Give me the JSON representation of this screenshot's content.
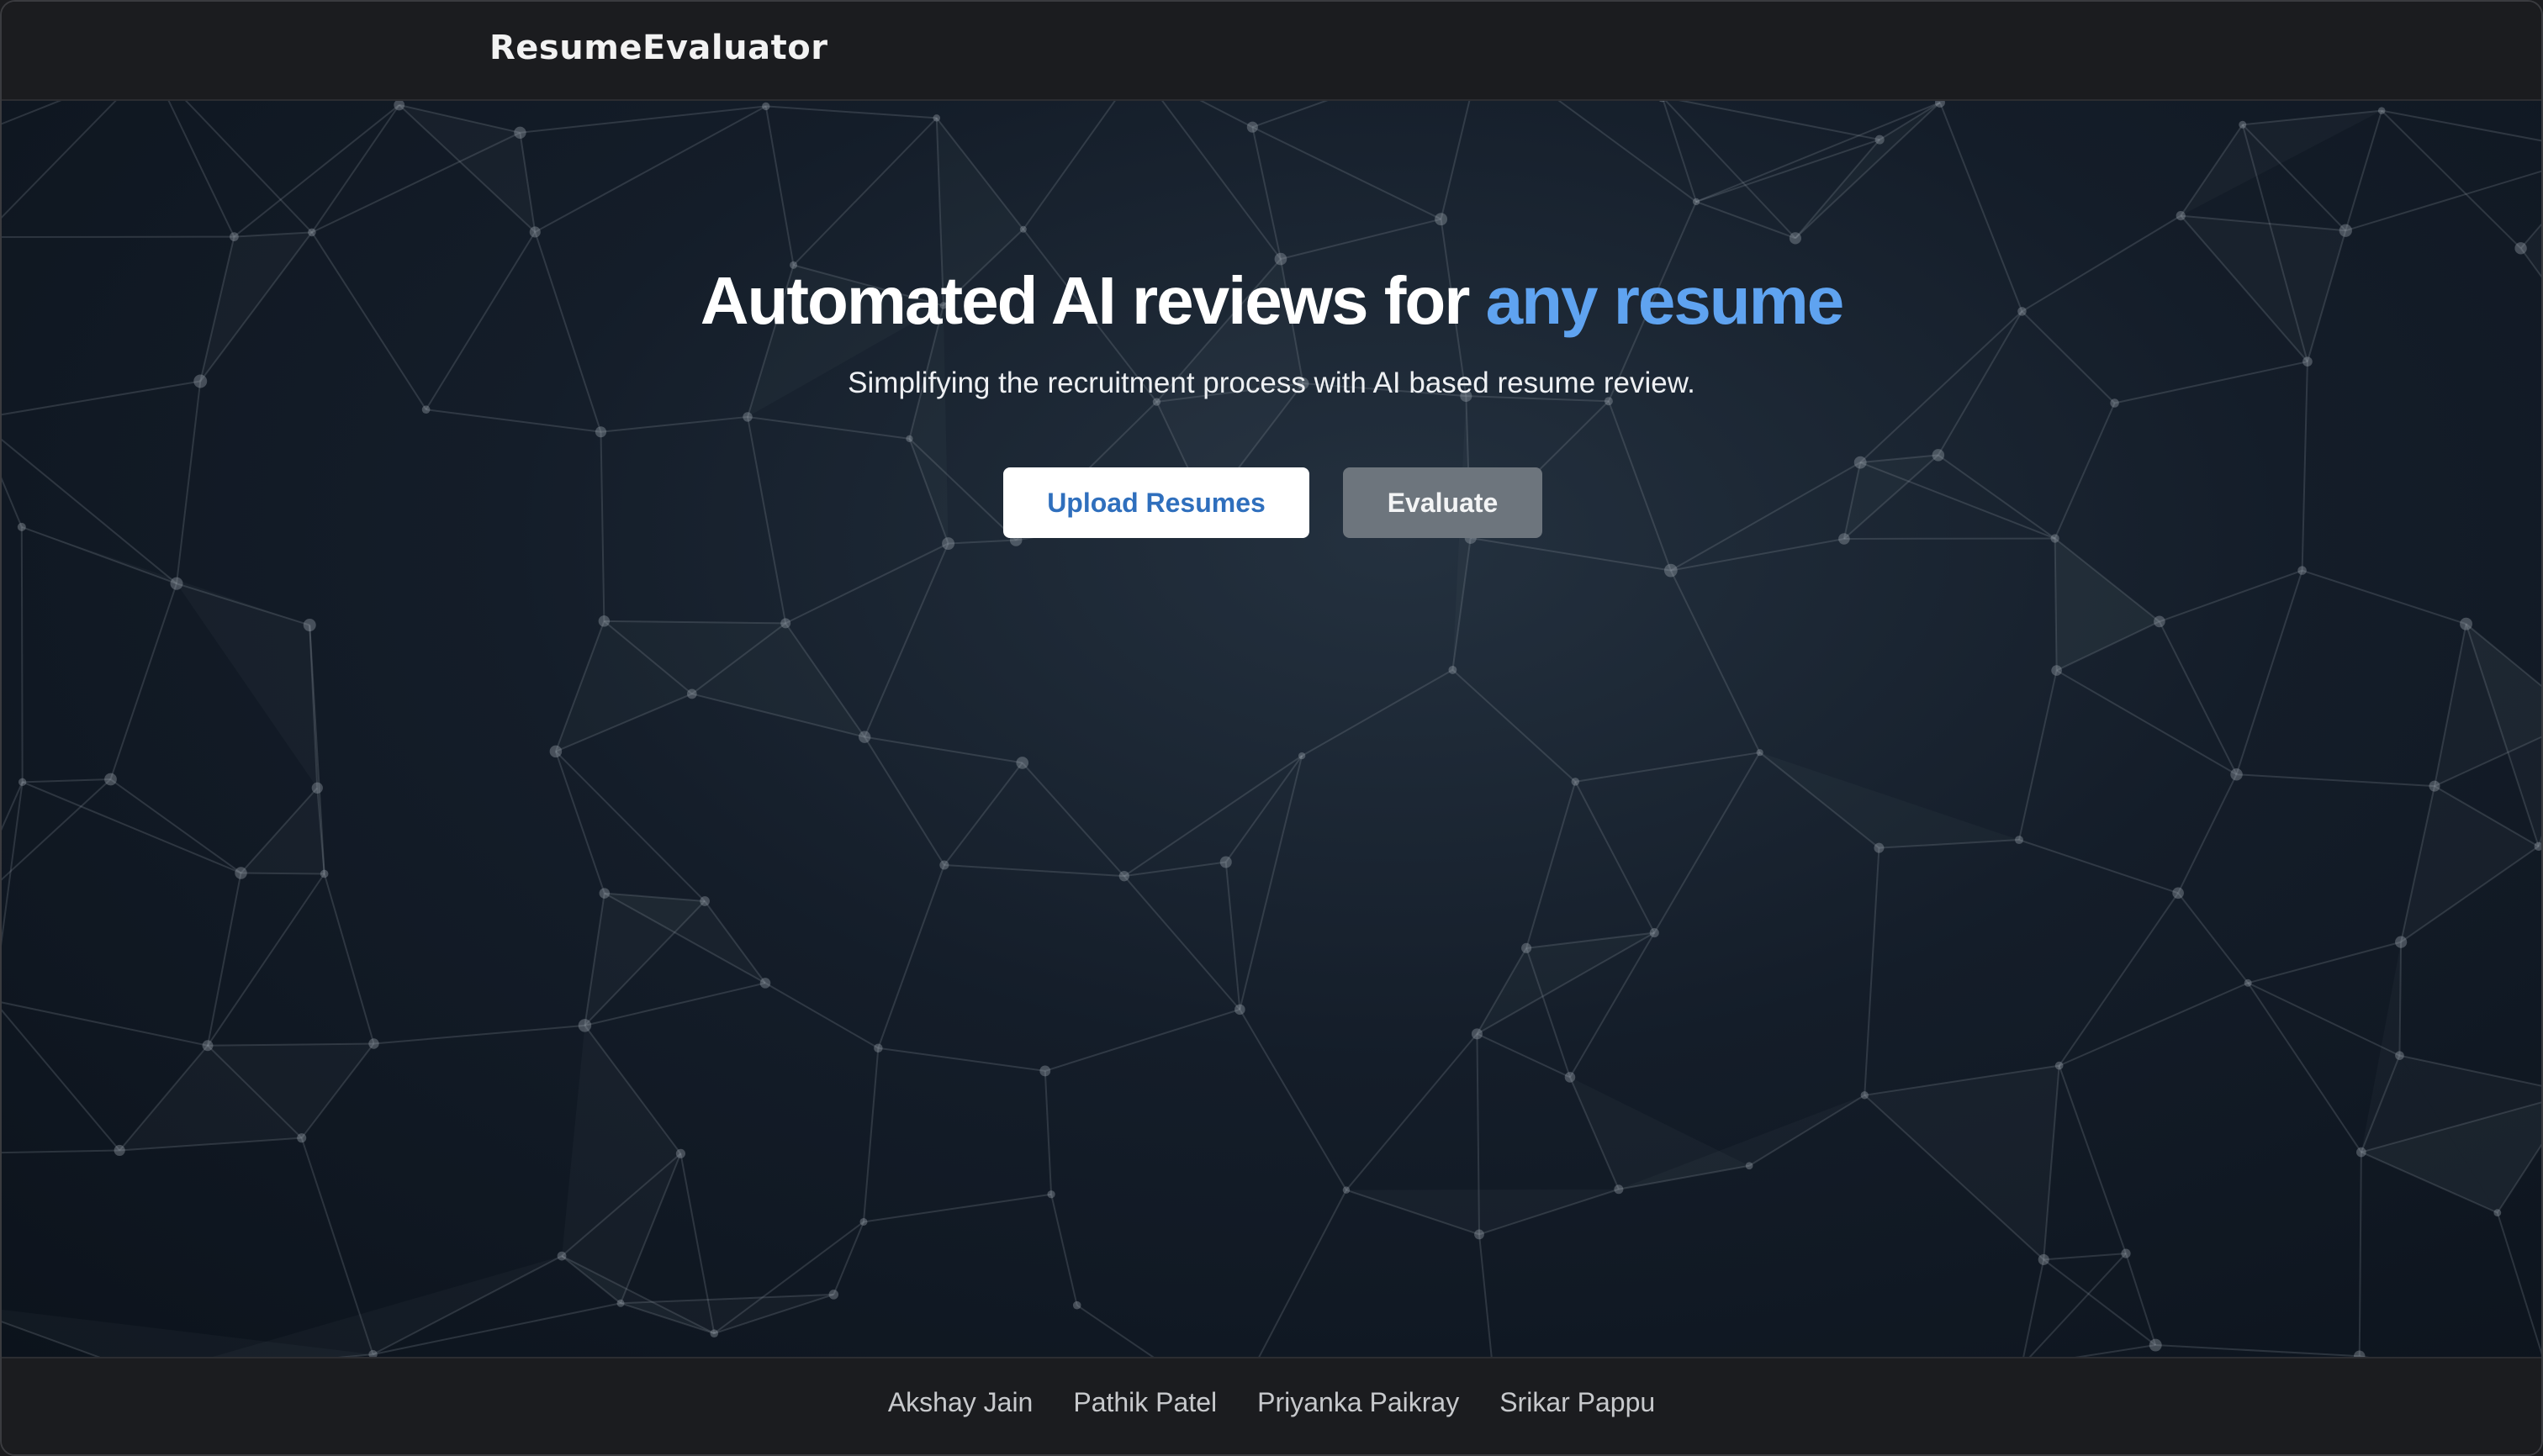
{
  "navbar": {
    "brand": "ResumeEvaluator"
  },
  "hero": {
    "headline_main": "Automated AI reviews for ",
    "headline_accent": "any resume",
    "subtitle": "Simplifying the recruitment process with AI based resume review.",
    "upload_button": "Upload Resumes",
    "evaluate_button": "Evaluate"
  },
  "footer": {
    "names": [
      "Akshay Jain",
      "Pathik Patel",
      "Priyanka Paikray",
      "Srikar Pappu"
    ]
  },
  "colors": {
    "accent": "#5fa3f0",
    "upload_text": "#2f6fbd",
    "evaluate_bg": "#6d757d",
    "bar_bg": "#1b1c1f"
  }
}
